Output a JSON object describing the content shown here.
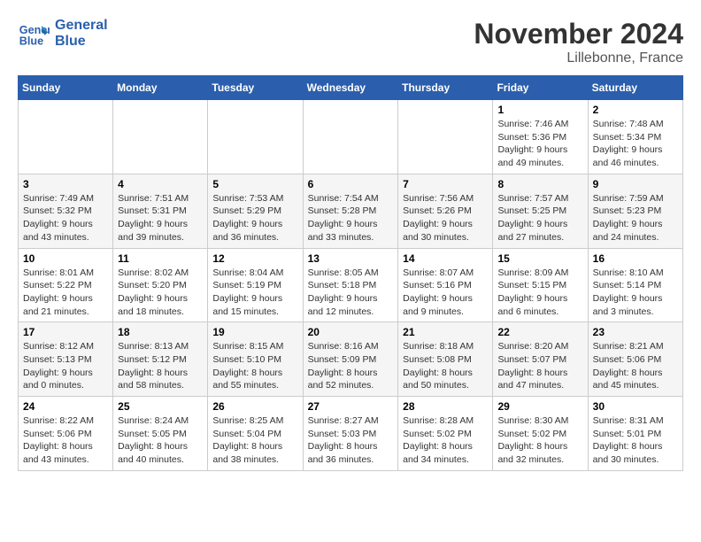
{
  "logo": {
    "line1": "General",
    "line2": "Blue"
  },
  "title": "November 2024",
  "location": "Lillebonne, France",
  "weekdays": [
    "Sunday",
    "Monday",
    "Tuesday",
    "Wednesday",
    "Thursday",
    "Friday",
    "Saturday"
  ],
  "weeks": [
    [
      {
        "day": "",
        "info": ""
      },
      {
        "day": "",
        "info": ""
      },
      {
        "day": "",
        "info": ""
      },
      {
        "day": "",
        "info": ""
      },
      {
        "day": "",
        "info": ""
      },
      {
        "day": "1",
        "info": "Sunrise: 7:46 AM\nSunset: 5:36 PM\nDaylight: 9 hours\nand 49 minutes."
      },
      {
        "day": "2",
        "info": "Sunrise: 7:48 AM\nSunset: 5:34 PM\nDaylight: 9 hours\nand 46 minutes."
      }
    ],
    [
      {
        "day": "3",
        "info": "Sunrise: 7:49 AM\nSunset: 5:32 PM\nDaylight: 9 hours\nand 43 minutes."
      },
      {
        "day": "4",
        "info": "Sunrise: 7:51 AM\nSunset: 5:31 PM\nDaylight: 9 hours\nand 39 minutes."
      },
      {
        "day": "5",
        "info": "Sunrise: 7:53 AM\nSunset: 5:29 PM\nDaylight: 9 hours\nand 36 minutes."
      },
      {
        "day": "6",
        "info": "Sunrise: 7:54 AM\nSunset: 5:28 PM\nDaylight: 9 hours\nand 33 minutes."
      },
      {
        "day": "7",
        "info": "Sunrise: 7:56 AM\nSunset: 5:26 PM\nDaylight: 9 hours\nand 30 minutes."
      },
      {
        "day": "8",
        "info": "Sunrise: 7:57 AM\nSunset: 5:25 PM\nDaylight: 9 hours\nand 27 minutes."
      },
      {
        "day": "9",
        "info": "Sunrise: 7:59 AM\nSunset: 5:23 PM\nDaylight: 9 hours\nand 24 minutes."
      }
    ],
    [
      {
        "day": "10",
        "info": "Sunrise: 8:01 AM\nSunset: 5:22 PM\nDaylight: 9 hours\nand 21 minutes."
      },
      {
        "day": "11",
        "info": "Sunrise: 8:02 AM\nSunset: 5:20 PM\nDaylight: 9 hours\nand 18 minutes."
      },
      {
        "day": "12",
        "info": "Sunrise: 8:04 AM\nSunset: 5:19 PM\nDaylight: 9 hours\nand 15 minutes."
      },
      {
        "day": "13",
        "info": "Sunrise: 8:05 AM\nSunset: 5:18 PM\nDaylight: 9 hours\nand 12 minutes."
      },
      {
        "day": "14",
        "info": "Sunrise: 8:07 AM\nSunset: 5:16 PM\nDaylight: 9 hours\nand 9 minutes."
      },
      {
        "day": "15",
        "info": "Sunrise: 8:09 AM\nSunset: 5:15 PM\nDaylight: 9 hours\nand 6 minutes."
      },
      {
        "day": "16",
        "info": "Sunrise: 8:10 AM\nSunset: 5:14 PM\nDaylight: 9 hours\nand 3 minutes."
      }
    ],
    [
      {
        "day": "17",
        "info": "Sunrise: 8:12 AM\nSunset: 5:13 PM\nDaylight: 9 hours\nand 0 minutes."
      },
      {
        "day": "18",
        "info": "Sunrise: 8:13 AM\nSunset: 5:12 PM\nDaylight: 8 hours\nand 58 minutes."
      },
      {
        "day": "19",
        "info": "Sunrise: 8:15 AM\nSunset: 5:10 PM\nDaylight: 8 hours\nand 55 minutes."
      },
      {
        "day": "20",
        "info": "Sunrise: 8:16 AM\nSunset: 5:09 PM\nDaylight: 8 hours\nand 52 minutes."
      },
      {
        "day": "21",
        "info": "Sunrise: 8:18 AM\nSunset: 5:08 PM\nDaylight: 8 hours\nand 50 minutes."
      },
      {
        "day": "22",
        "info": "Sunrise: 8:20 AM\nSunset: 5:07 PM\nDaylight: 8 hours\nand 47 minutes."
      },
      {
        "day": "23",
        "info": "Sunrise: 8:21 AM\nSunset: 5:06 PM\nDaylight: 8 hours\nand 45 minutes."
      }
    ],
    [
      {
        "day": "24",
        "info": "Sunrise: 8:22 AM\nSunset: 5:06 PM\nDaylight: 8 hours\nand 43 minutes."
      },
      {
        "day": "25",
        "info": "Sunrise: 8:24 AM\nSunset: 5:05 PM\nDaylight: 8 hours\nand 40 minutes."
      },
      {
        "day": "26",
        "info": "Sunrise: 8:25 AM\nSunset: 5:04 PM\nDaylight: 8 hours\nand 38 minutes."
      },
      {
        "day": "27",
        "info": "Sunrise: 8:27 AM\nSunset: 5:03 PM\nDaylight: 8 hours\nand 36 minutes."
      },
      {
        "day": "28",
        "info": "Sunrise: 8:28 AM\nSunset: 5:02 PM\nDaylight: 8 hours\nand 34 minutes."
      },
      {
        "day": "29",
        "info": "Sunrise: 8:30 AM\nSunset: 5:02 PM\nDaylight: 8 hours\nand 32 minutes."
      },
      {
        "day": "30",
        "info": "Sunrise: 8:31 AM\nSunset: 5:01 PM\nDaylight: 8 hours\nand 30 minutes."
      }
    ]
  ]
}
